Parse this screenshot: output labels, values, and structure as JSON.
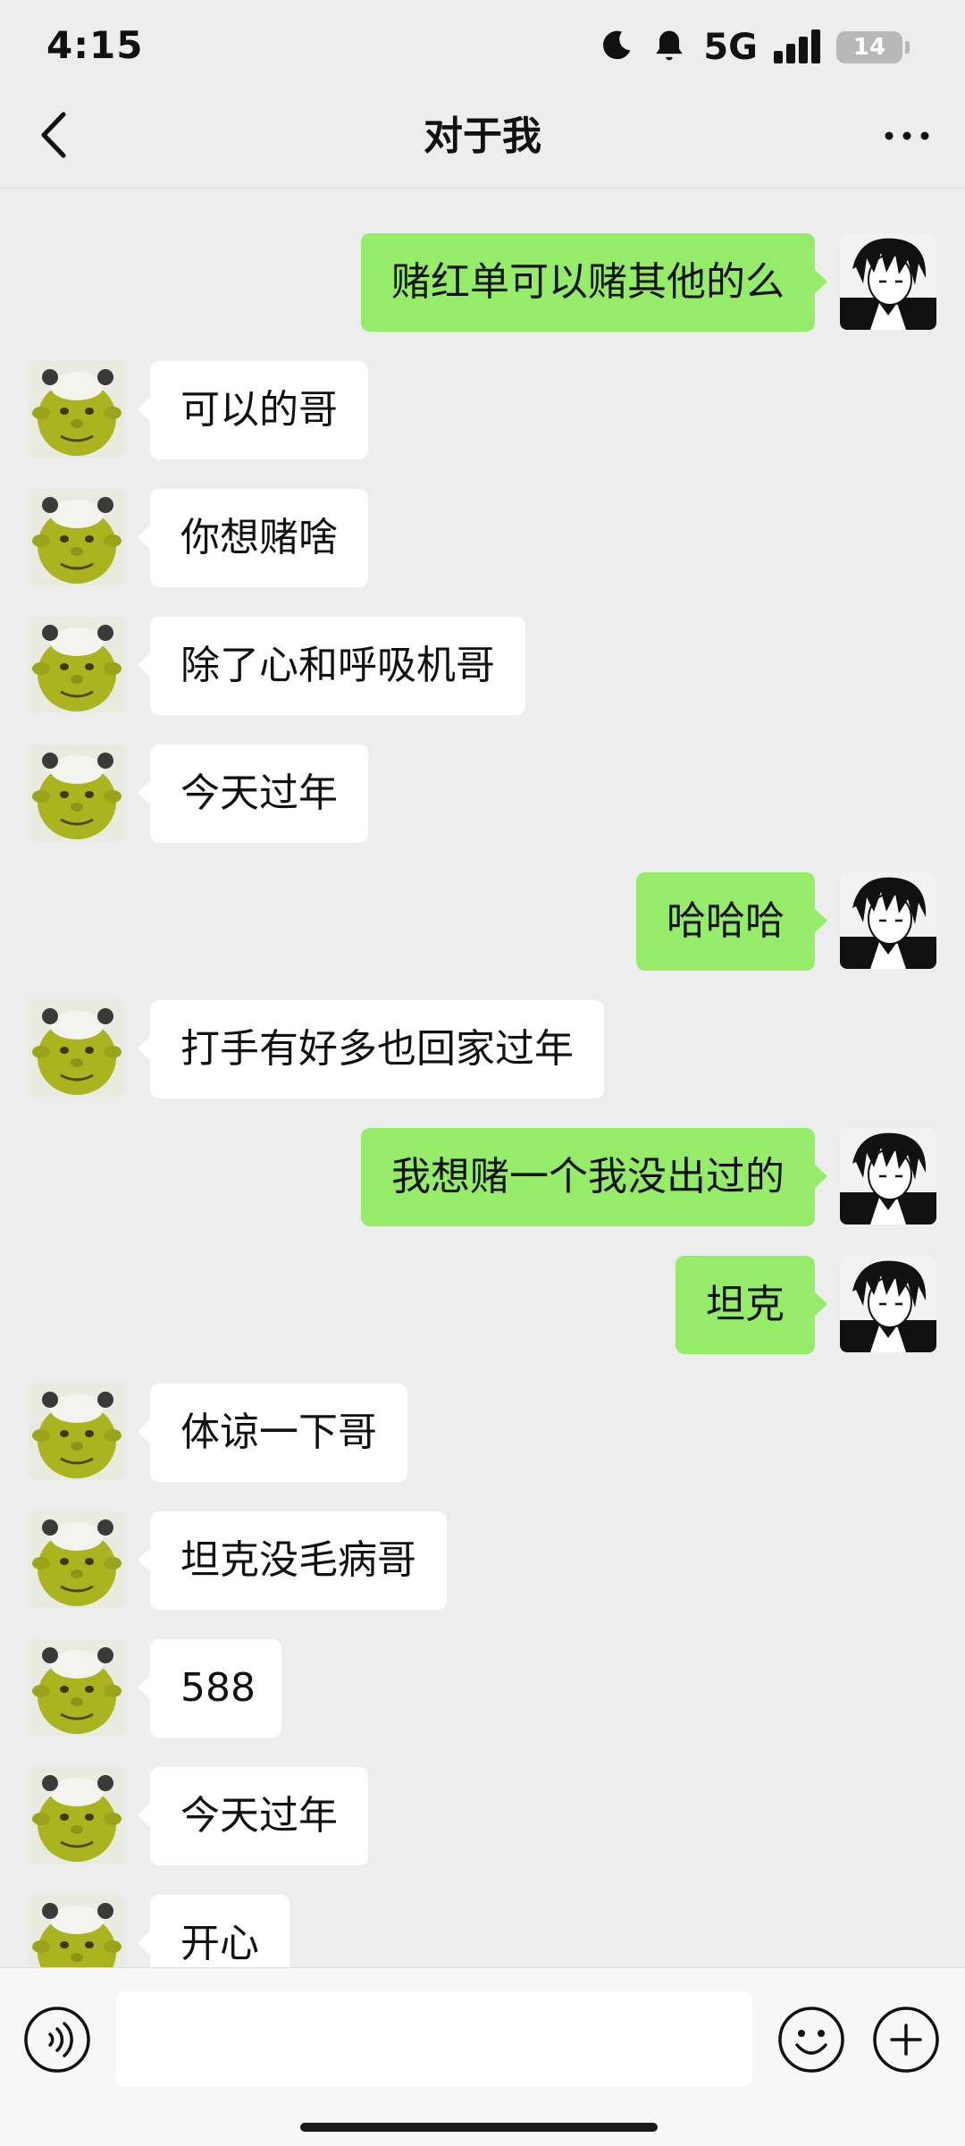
{
  "status_bar": {
    "time": "4:15",
    "network": "5G",
    "battery": "14",
    "icons": [
      "moon-icon",
      "bell-icon",
      "signal-icon",
      "battery-icon"
    ]
  },
  "nav": {
    "title": "对于我",
    "back_icon": "chevron-left-icon",
    "more_icon": "more-icon"
  },
  "colors": {
    "background": "#ededed",
    "self_bubble": "#95ec69",
    "other_bubble": "#ffffff"
  },
  "messages": [
    {
      "side": "right",
      "text": "赌红单可以赌其他的么"
    },
    {
      "side": "left",
      "text": "可以的哥"
    },
    {
      "side": "left",
      "text": "你想赌啥"
    },
    {
      "side": "left",
      "text": "除了心和呼吸机哥"
    },
    {
      "side": "left",
      "text": "今天过年"
    },
    {
      "side": "right",
      "text": "哈哈哈"
    },
    {
      "side": "left",
      "text": "打手有好多也回家过年"
    },
    {
      "side": "right",
      "text": "我想赌一个我没出过的"
    },
    {
      "side": "right",
      "text": "坦克"
    },
    {
      "side": "left",
      "text": "体谅一下哥"
    },
    {
      "side": "left",
      "text": "坦克没毛病哥"
    },
    {
      "side": "left",
      "text": "588"
    },
    {
      "side": "left",
      "text": "今天过年"
    },
    {
      "side": "left",
      "text": "开心"
    }
  ],
  "input_bar": {
    "value": "",
    "icons": [
      "voice-icon",
      "emoji-icon",
      "plus-icon"
    ]
  }
}
